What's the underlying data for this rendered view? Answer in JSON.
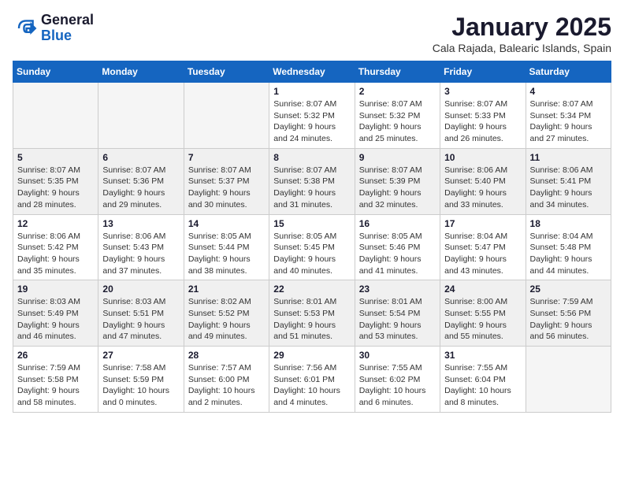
{
  "header": {
    "logo_general": "General",
    "logo_blue": "Blue",
    "month_title": "January 2025",
    "location": "Cala Rajada, Balearic Islands, Spain"
  },
  "days_of_week": [
    "Sunday",
    "Monday",
    "Tuesday",
    "Wednesday",
    "Thursday",
    "Friday",
    "Saturday"
  ],
  "weeks": [
    [
      {
        "day": "",
        "info": ""
      },
      {
        "day": "",
        "info": ""
      },
      {
        "day": "",
        "info": ""
      },
      {
        "day": "1",
        "info": "Sunrise: 8:07 AM\nSunset: 5:32 PM\nDaylight: 9 hours and 24 minutes."
      },
      {
        "day": "2",
        "info": "Sunrise: 8:07 AM\nSunset: 5:32 PM\nDaylight: 9 hours and 25 minutes."
      },
      {
        "day": "3",
        "info": "Sunrise: 8:07 AM\nSunset: 5:33 PM\nDaylight: 9 hours and 26 minutes."
      },
      {
        "day": "4",
        "info": "Sunrise: 8:07 AM\nSunset: 5:34 PM\nDaylight: 9 hours and 27 minutes."
      }
    ],
    [
      {
        "day": "5",
        "info": "Sunrise: 8:07 AM\nSunset: 5:35 PM\nDaylight: 9 hours and 28 minutes."
      },
      {
        "day": "6",
        "info": "Sunrise: 8:07 AM\nSunset: 5:36 PM\nDaylight: 9 hours and 29 minutes."
      },
      {
        "day": "7",
        "info": "Sunrise: 8:07 AM\nSunset: 5:37 PM\nDaylight: 9 hours and 30 minutes."
      },
      {
        "day": "8",
        "info": "Sunrise: 8:07 AM\nSunset: 5:38 PM\nDaylight: 9 hours and 31 minutes."
      },
      {
        "day": "9",
        "info": "Sunrise: 8:07 AM\nSunset: 5:39 PM\nDaylight: 9 hours and 32 minutes."
      },
      {
        "day": "10",
        "info": "Sunrise: 8:06 AM\nSunset: 5:40 PM\nDaylight: 9 hours and 33 minutes."
      },
      {
        "day": "11",
        "info": "Sunrise: 8:06 AM\nSunset: 5:41 PM\nDaylight: 9 hours and 34 minutes."
      }
    ],
    [
      {
        "day": "12",
        "info": "Sunrise: 8:06 AM\nSunset: 5:42 PM\nDaylight: 9 hours and 35 minutes."
      },
      {
        "day": "13",
        "info": "Sunrise: 8:06 AM\nSunset: 5:43 PM\nDaylight: 9 hours and 37 minutes."
      },
      {
        "day": "14",
        "info": "Sunrise: 8:05 AM\nSunset: 5:44 PM\nDaylight: 9 hours and 38 minutes."
      },
      {
        "day": "15",
        "info": "Sunrise: 8:05 AM\nSunset: 5:45 PM\nDaylight: 9 hours and 40 minutes."
      },
      {
        "day": "16",
        "info": "Sunrise: 8:05 AM\nSunset: 5:46 PM\nDaylight: 9 hours and 41 minutes."
      },
      {
        "day": "17",
        "info": "Sunrise: 8:04 AM\nSunset: 5:47 PM\nDaylight: 9 hours and 43 minutes."
      },
      {
        "day": "18",
        "info": "Sunrise: 8:04 AM\nSunset: 5:48 PM\nDaylight: 9 hours and 44 minutes."
      }
    ],
    [
      {
        "day": "19",
        "info": "Sunrise: 8:03 AM\nSunset: 5:49 PM\nDaylight: 9 hours and 46 minutes."
      },
      {
        "day": "20",
        "info": "Sunrise: 8:03 AM\nSunset: 5:51 PM\nDaylight: 9 hours and 47 minutes."
      },
      {
        "day": "21",
        "info": "Sunrise: 8:02 AM\nSunset: 5:52 PM\nDaylight: 9 hours and 49 minutes."
      },
      {
        "day": "22",
        "info": "Sunrise: 8:01 AM\nSunset: 5:53 PM\nDaylight: 9 hours and 51 minutes."
      },
      {
        "day": "23",
        "info": "Sunrise: 8:01 AM\nSunset: 5:54 PM\nDaylight: 9 hours and 53 minutes."
      },
      {
        "day": "24",
        "info": "Sunrise: 8:00 AM\nSunset: 5:55 PM\nDaylight: 9 hours and 55 minutes."
      },
      {
        "day": "25",
        "info": "Sunrise: 7:59 AM\nSunset: 5:56 PM\nDaylight: 9 hours and 56 minutes."
      }
    ],
    [
      {
        "day": "26",
        "info": "Sunrise: 7:59 AM\nSunset: 5:58 PM\nDaylight: 9 hours and 58 minutes."
      },
      {
        "day": "27",
        "info": "Sunrise: 7:58 AM\nSunset: 5:59 PM\nDaylight: 10 hours and 0 minutes."
      },
      {
        "day": "28",
        "info": "Sunrise: 7:57 AM\nSunset: 6:00 PM\nDaylight: 10 hours and 2 minutes."
      },
      {
        "day": "29",
        "info": "Sunrise: 7:56 AM\nSunset: 6:01 PM\nDaylight: 10 hours and 4 minutes."
      },
      {
        "day": "30",
        "info": "Sunrise: 7:55 AM\nSunset: 6:02 PM\nDaylight: 10 hours and 6 minutes."
      },
      {
        "day": "31",
        "info": "Sunrise: 7:55 AM\nSunset: 6:04 PM\nDaylight: 10 hours and 8 minutes."
      },
      {
        "day": "",
        "info": ""
      }
    ]
  ],
  "shaded_rows": [
    1,
    3
  ]
}
